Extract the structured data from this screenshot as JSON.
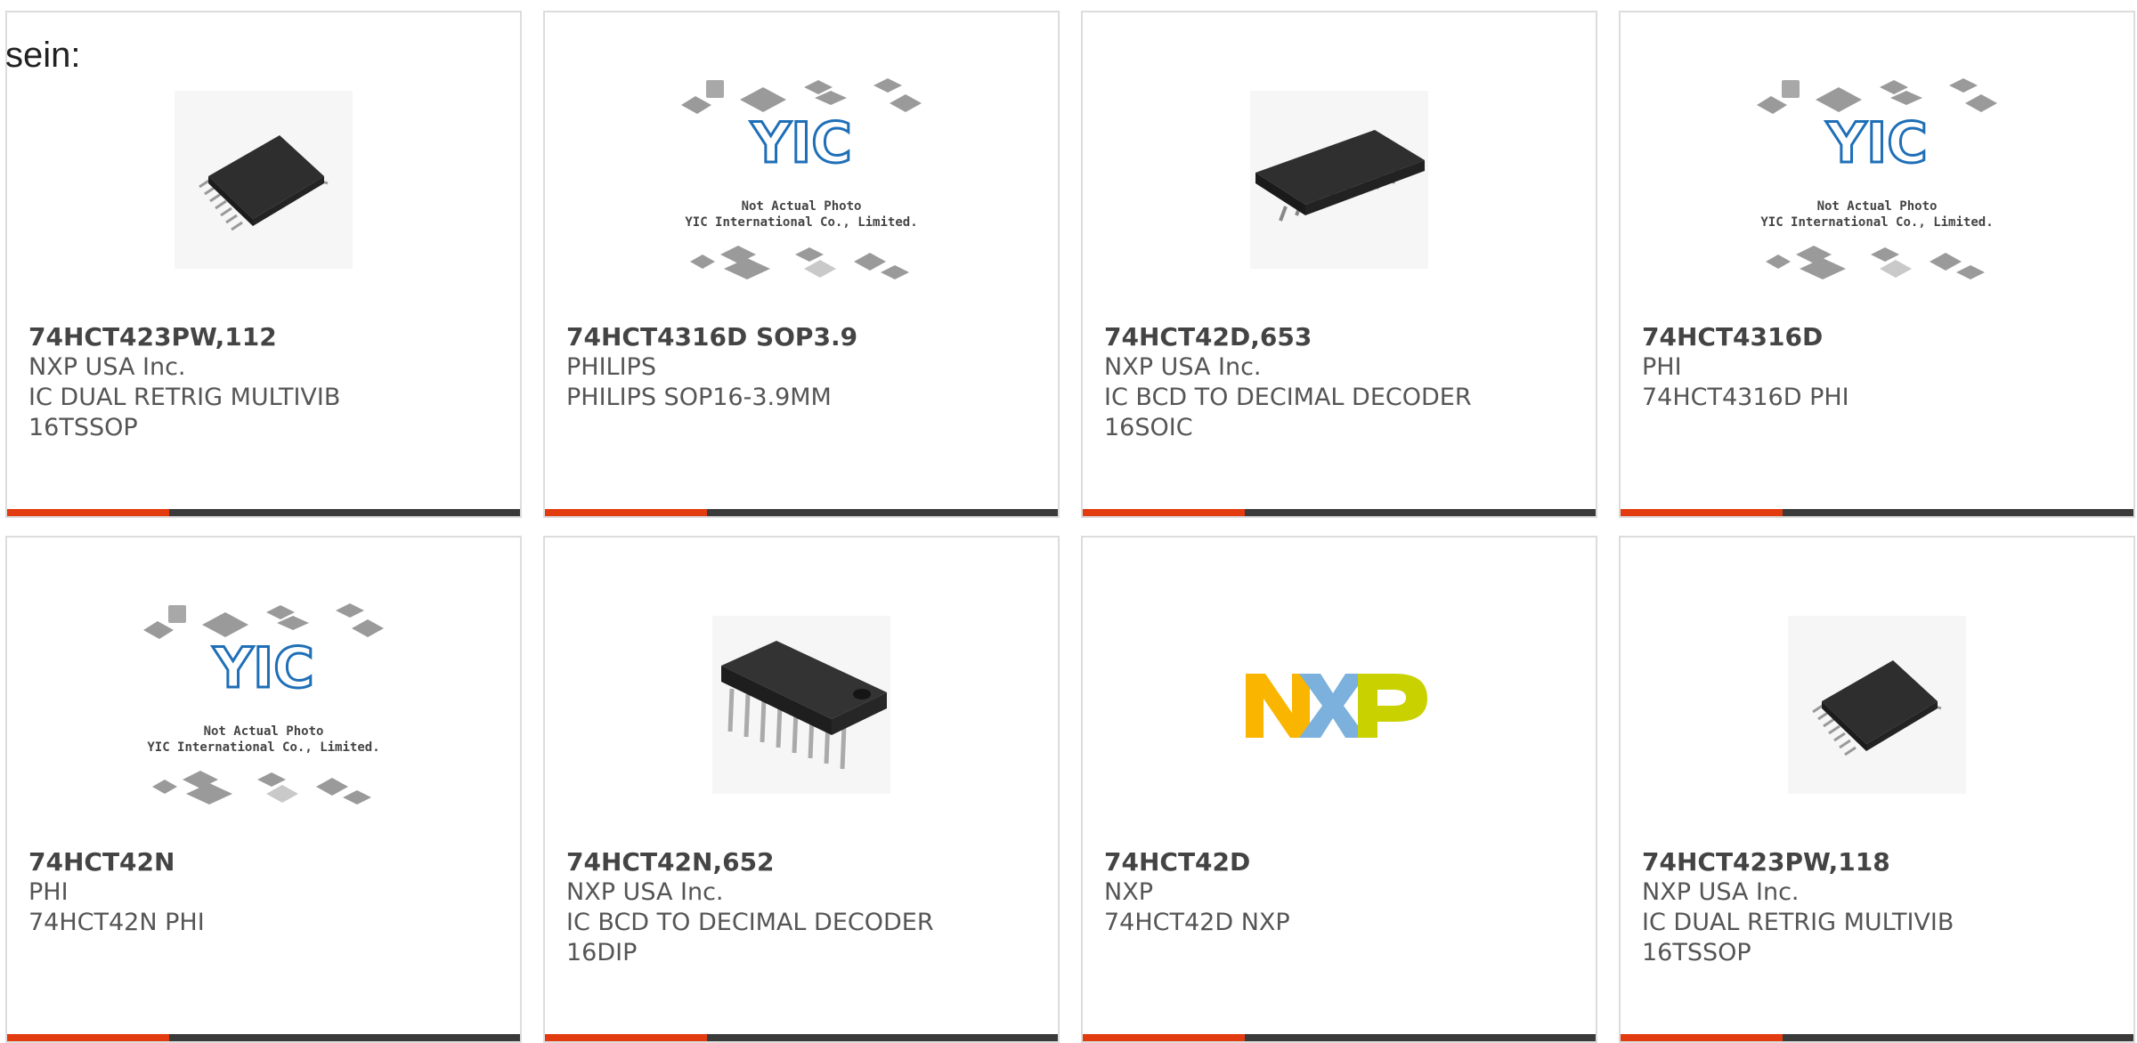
{
  "heading": "sein:",
  "placeholder_caption_1": "Not Actual Photo",
  "placeholder_caption_2": "YIC International Co., Limited.",
  "placeholder_logo": "YIC",
  "nxp_logo": "NXP",
  "products": [
    {
      "part": "74HCT423PW,112",
      "maker": "NXP USA Inc.",
      "desc1": "IC DUAL RETRIG MULTIVIB",
      "desc2": "16TSSOP",
      "image": "tssop-chip"
    },
    {
      "part": "74HCT4316D SOP3.9",
      "maker": "PHILIPS",
      "desc1": "PHILIPS SOP16-3.9MM",
      "desc2": "",
      "image": "yic-placeholder"
    },
    {
      "part": "74HCT42D,653",
      "maker": "NXP USA Inc.",
      "desc1": "IC BCD TO DECIMAL DECODER",
      "desc2": "16SOIC",
      "image": "soic-chip"
    },
    {
      "part": "74HCT4316D",
      "maker": "PHI",
      "desc1": "74HCT4316D PHI",
      "desc2": "",
      "image": "yic-placeholder"
    },
    {
      "part": "74HCT42N",
      "maker": "PHI",
      "desc1": "74HCT42N PHI",
      "desc2": "",
      "image": "yic-placeholder"
    },
    {
      "part": "74HCT42N,652",
      "maker": "NXP USA Inc.",
      "desc1": "IC BCD TO DECIMAL DECODER",
      "desc2": "16DIP",
      "image": "dip-chip"
    },
    {
      "part": "74HCT42D",
      "maker": "NXP",
      "desc1": "74HCT42D NXP",
      "desc2": "",
      "image": "nxp-logo"
    },
    {
      "part": "74HCT423PW,118",
      "maker": "NXP USA Inc.",
      "desc1": "IC DUAL RETRIG MULTIVIB",
      "desc2": "16TSSOP",
      "image": "tssop-chip"
    }
  ],
  "colors": {
    "accent": "#e23b10",
    "bar": "#3a3a3a",
    "border": "#dcdcdc",
    "text": "#555555"
  }
}
